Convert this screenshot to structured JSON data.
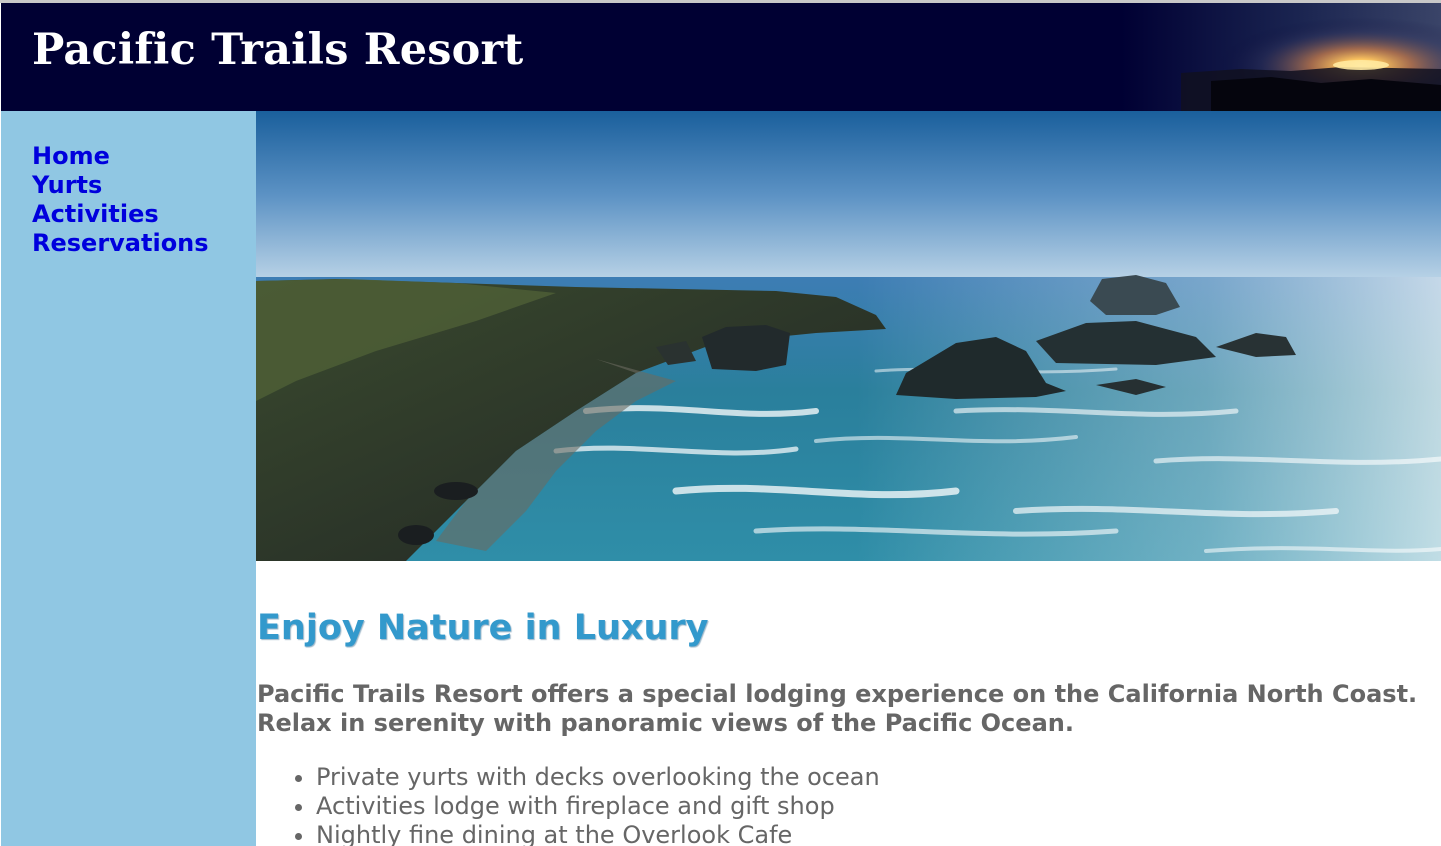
{
  "header": {
    "title": "Pacific Trails Resort"
  },
  "nav": {
    "items": [
      {
        "label": "Home"
      },
      {
        "label": "Yurts"
      },
      {
        "label": "Activities"
      },
      {
        "label": "Reservations"
      }
    ]
  },
  "hero": {
    "icon": "coastline-photo"
  },
  "main": {
    "heading": "Enjoy Nature in Luxury",
    "intro_line1": "Pacific Trails Resort offers a special lodging experience on the California North Coast.",
    "intro_line2": "Relax in serenity with panoramic views of the Pacific Ocean.",
    "features": [
      "Private yurts with decks overlooking the ocean",
      "Activities lodge with fireplace and gift shop",
      "Nightly fine dining at the Overlook Cafe"
    ]
  },
  "colors": {
    "header_bg": "#000033",
    "nav_bg": "#90c7e3",
    "nav_link": "#0000dd",
    "heading": "#3399cc",
    "body_text": "#666666"
  }
}
